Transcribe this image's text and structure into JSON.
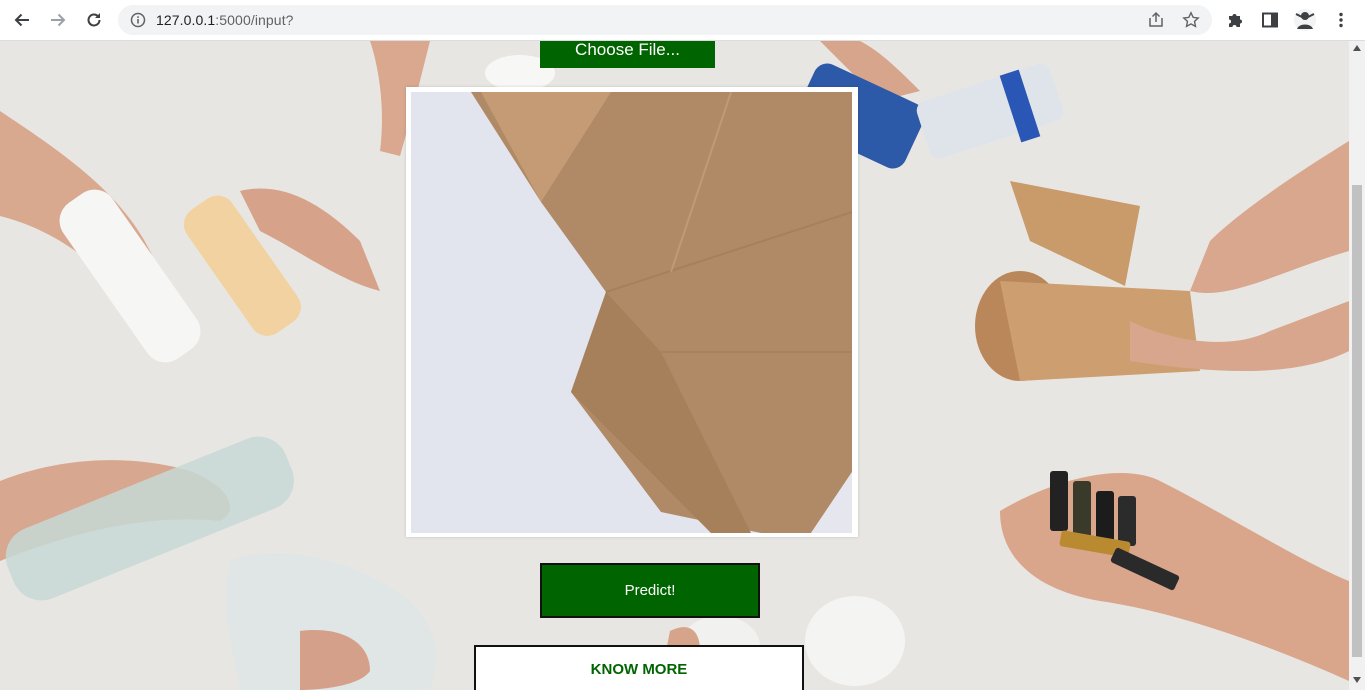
{
  "browser": {
    "url_host": "127.0.0.1",
    "url_path": ":5000/input?",
    "icons": [
      "back-arrow-icon",
      "forward-arrow-icon",
      "reload-icon",
      "site-info-icon",
      "share-icon",
      "bookmark-star-icon",
      "extensions-puzzle-icon",
      "side-panel-icon",
      "profile-avatar-icon",
      "more-menu-icon"
    ]
  },
  "page": {
    "choose_file_label": "Choose File...",
    "predict_label": "Predict!",
    "know_more_label": "KNOW MORE",
    "accent_color": "#006400"
  }
}
